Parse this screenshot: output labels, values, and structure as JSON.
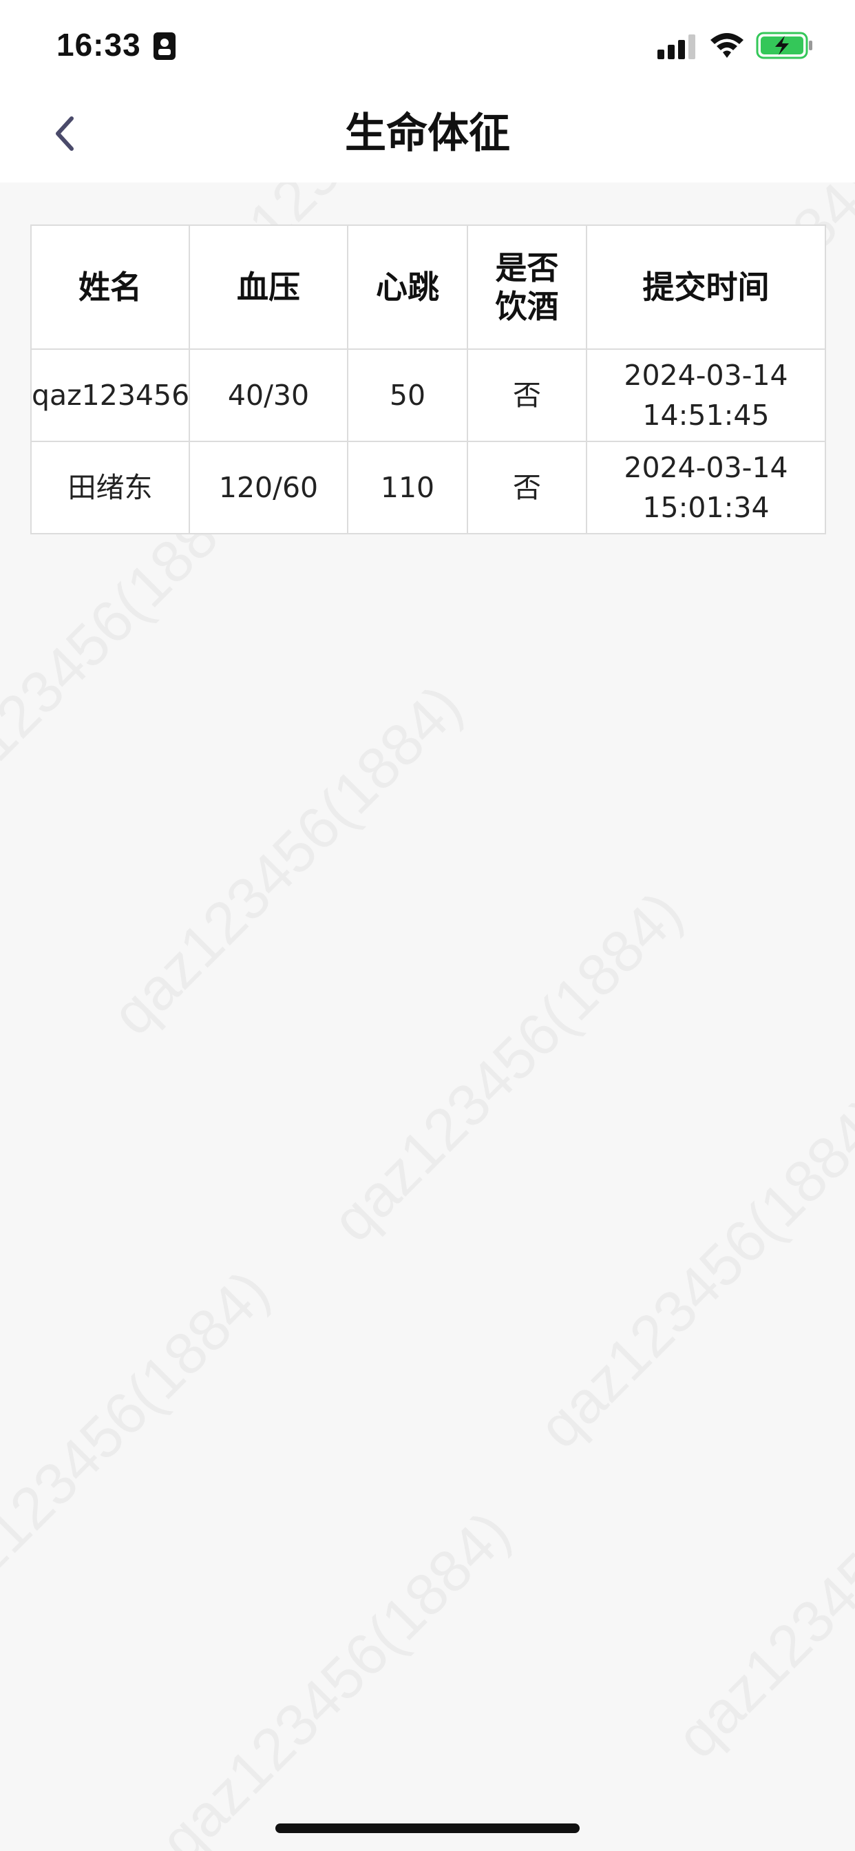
{
  "status_bar": {
    "time": "16:33",
    "icons": [
      "badge-icon",
      "signal-icon",
      "wifi-icon",
      "battery-charging-icon"
    ],
    "battery_color": "#34c759"
  },
  "nav": {
    "title": "生命体征",
    "back_icon": "chevron-left-icon",
    "back_color": "#4a4a6a"
  },
  "table": {
    "headers": [
      {
        "lines": [
          "姓名"
        ]
      },
      {
        "lines": [
          "血压"
        ]
      },
      {
        "lines": [
          "心跳"
        ]
      },
      {
        "lines": [
          "是否",
          "饮酒"
        ]
      },
      {
        "lines": [
          "提交时间"
        ]
      }
    ],
    "rows": [
      {
        "name": "qaz123456",
        "blood_pressure": "40/30",
        "heartbeat": "50",
        "drinking": "否",
        "submit_date": "2024-03-14",
        "submit_time": "14:51:45"
      },
      {
        "name": "田绪东",
        "blood_pressure": "120/60",
        "heartbeat": "110",
        "drinking": "否",
        "submit_date": "2024-03-14",
        "submit_time": "15:01:34"
      }
    ]
  },
  "watermark": {
    "text": "qaz123456(1884)"
  }
}
